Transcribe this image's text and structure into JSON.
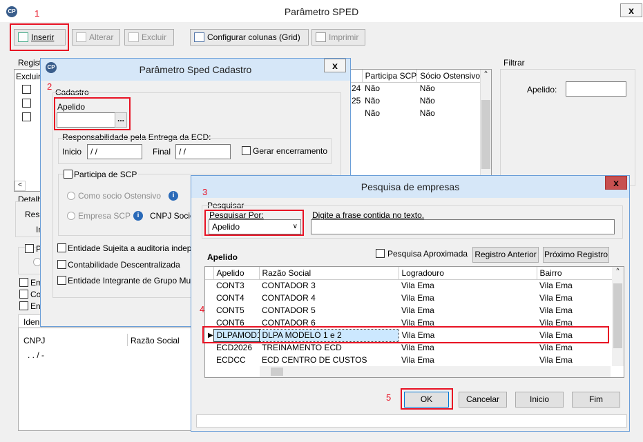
{
  "main": {
    "title": "Parâmetro SPED",
    "close": "x",
    "toolbar": {
      "insert": "Inserir",
      "alter": "Alterar",
      "delete": "Excluir",
      "configure": "Configurar colunas (Grid)",
      "print": "Imprimir"
    },
    "registros_label": "Regist",
    "excluir_col": "Excluir",
    "grid": {
      "headers": [
        "Participa SCP",
        "Sócio Ostensivo"
      ],
      "rows": [
        {
          "a": "24",
          "b": "Não",
          "c": "Não"
        },
        {
          "a": "25",
          "b": "Não",
          "c": "Não"
        },
        {
          "a": "",
          "b": "Não",
          "c": "Não"
        }
      ]
    },
    "filtrar": {
      "title": "Filtrar",
      "apelido_label": "Apelido:"
    },
    "detalhe_label": "Detalh",
    "resp_label": "Resp",
    "in_label": "In",
    "left_checks": [
      "Em",
      "Co",
      "En"
    ],
    "p_label": "P",
    "identif_label": "Iden",
    "cnpj_grid": {
      "headers": [
        "CNPJ",
        "Razão Social"
      ],
      "row": ". . /  -"
    }
  },
  "cadastro": {
    "title": "Parâmetro Sped Cadastro",
    "close": "x",
    "group": "Cadastro",
    "apelido_label": "Apelido",
    "ellipsis": "...",
    "resp_label": "Responsabilidade pela Entrega da ECD:",
    "inicio_label": "Inicio",
    "inicio_value": " / /",
    "final_label": "Final",
    "final_value": " / /",
    "gerar": "Gerar encerramento",
    "participa_scp": "Participa de SCP",
    "como_socio": "Como socio Ostensivo",
    "empresa_scp": "Empresa SCP",
    "cnpj_socio": "CNPJ Socio",
    "checks": [
      "Entidade Sujeita a auditoria indepe",
      "Contabilidade Descentralizada",
      "Entidade Integrante de Grupo Mul"
    ]
  },
  "pesquisa": {
    "title": "Pesquisa de empresas",
    "close": "x",
    "group": "Pesquisar",
    "pesquisar_por": "Pesquisar Por:",
    "select_value": "Apelido",
    "digite_label": "Digite a frase contida no texto.",
    "search_value": "",
    "grid_title": "Apelido",
    "aproximada": "Pesquisa Aproximada",
    "reg_anterior": "Registro Anterior",
    "prox_registro": "Próximo Registro",
    "headers": [
      "Apelido",
      "Razão Social",
      "Logradouro",
      "Bairro"
    ],
    "rows": [
      [
        "CONT3",
        "CONTADOR 3",
        "Vila Ema",
        "Vila Ema"
      ],
      [
        "CONT4",
        "CONTADOR 4",
        "Vila Ema",
        "Vila Ema"
      ],
      [
        "CONT5",
        "CONTADOR 5",
        "Vila Ema",
        "Vila Ema"
      ],
      [
        "CONT6",
        "CONTADOR 6",
        "Vila Ema",
        "Vila Ema"
      ],
      [
        "DLPAMOD1",
        "DLPA MODELO 1 e 2",
        "Vila Ema",
        "Vila Ema"
      ],
      [
        "ECD2026",
        "TREINAMENTO ECD",
        "Vila Ema",
        "Vila Ema"
      ],
      [
        "ECDCC",
        "ECD CENTRO DE CUSTOS",
        "Vila Ema",
        "Vila Ema"
      ]
    ],
    "ok": "OK",
    "cancelar": "Cancelar",
    "inicio": "Inicio",
    "fim": "Fim"
  },
  "annotations": [
    "1",
    "2",
    "3",
    "4",
    "5"
  ],
  "colors": {
    "red": "#e81123",
    "selection": "#cce8ff",
    "title_border": "#7a9cc0"
  }
}
